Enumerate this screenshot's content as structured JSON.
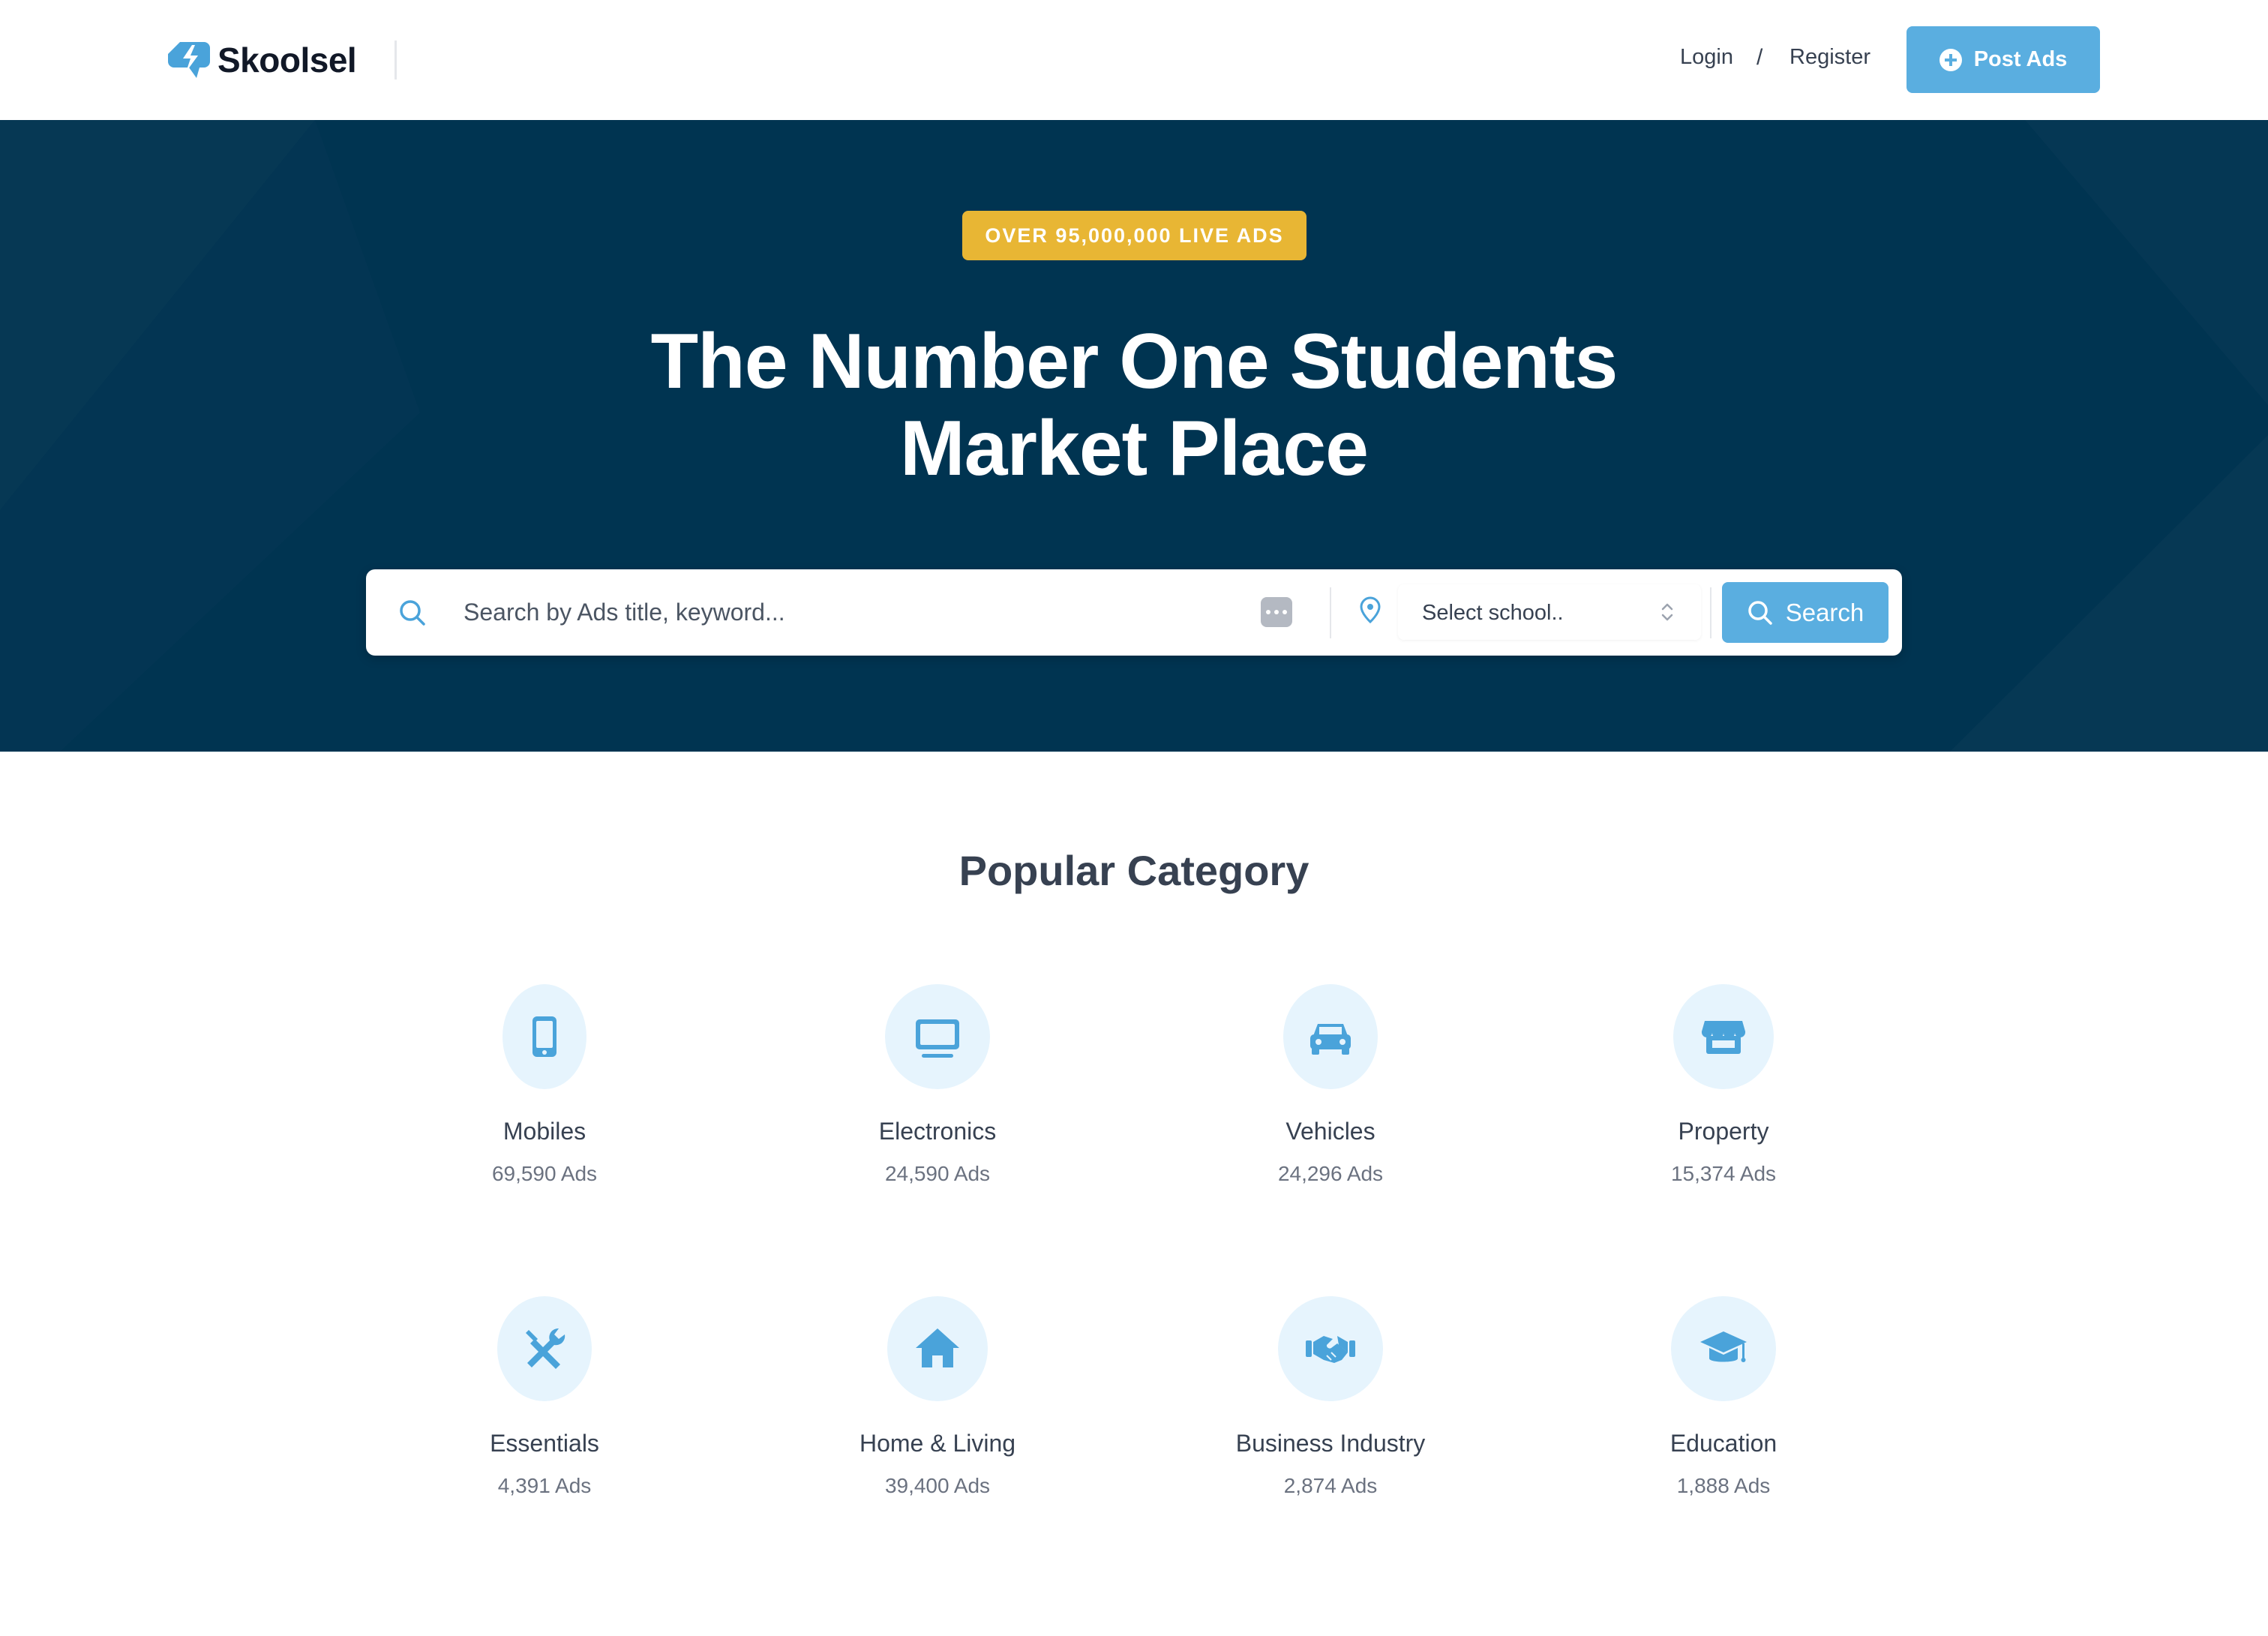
{
  "brand": {
    "name": "Skoolsel",
    "accent": "#5aaee0",
    "hero_bg": "#003451",
    "badge_bg": "#e8b634"
  },
  "nav": {
    "login": "Login",
    "separator": "/",
    "register": "Register",
    "post_ads": "Post Ads"
  },
  "hero": {
    "badge": "OVER 95,000,000 LIVE ADS",
    "title_line1": "The Number One Students",
    "title_line2": "Market Place"
  },
  "search": {
    "placeholder": "Search by Ads title, keyword...",
    "school_placeholder": "Select school..",
    "button": "Search"
  },
  "categories": {
    "title": "Popular Category",
    "items": [
      {
        "name": "Mobiles",
        "count": "69,590 Ads",
        "icon": "mobile-icon"
      },
      {
        "name": "Electronics",
        "count": "24,590 Ads",
        "icon": "monitor-icon"
      },
      {
        "name": "Vehicles",
        "count": "24,296 Ads",
        "icon": "car-icon"
      },
      {
        "name": "Property",
        "count": "15,374 Ads",
        "icon": "store-icon"
      },
      {
        "name": "Essentials",
        "count": "4,391 Ads",
        "icon": "tools-icon"
      },
      {
        "name": "Home & Living",
        "count": "39,400 Ads",
        "icon": "house-icon"
      },
      {
        "name": "Business Industry",
        "count": "2,874 Ads",
        "icon": "handshake-icon"
      },
      {
        "name": "Education",
        "count": "1,888 Ads",
        "icon": "graduation-cap-icon"
      }
    ]
  }
}
